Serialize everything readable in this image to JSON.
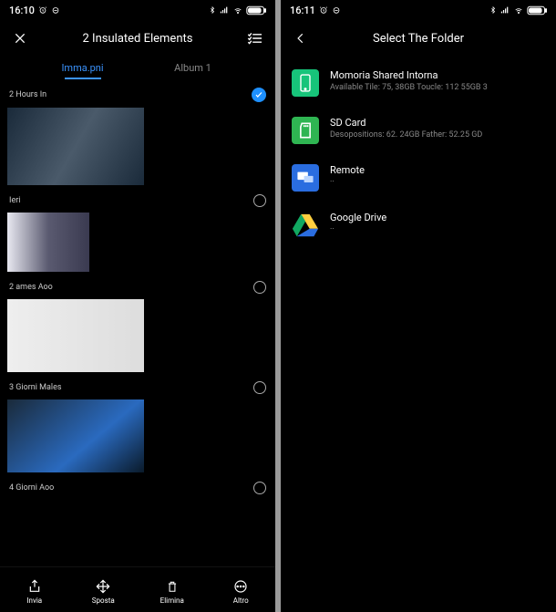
{
  "left": {
    "status": {
      "time": "16:10"
    },
    "header": {
      "title": "2 Insulated Elements"
    },
    "tabs": {
      "images": "Imma.pni",
      "album": "Album 1"
    },
    "sections": [
      {
        "label": "2 Hours In",
        "selected": true
      },
      {
        "label": "Ieri",
        "selected": false
      },
      {
        "label": "2 ames Aoo",
        "selected": false
      },
      {
        "label": "3 Giorni Males",
        "selected": false
      },
      {
        "label": "4 Giorni Aoo",
        "selected": false
      }
    ],
    "bottom": {
      "share": "Invia",
      "move": "Sposta",
      "delete": "Elimina",
      "more": "Altro"
    }
  },
  "right": {
    "status": {
      "time": "16:11"
    },
    "header": {
      "title": "Select The Folder"
    },
    "folders": [
      {
        "title": "Momoria Shared Intorna",
        "sub": "Available Tile: 75, 38GB Toucle: 112 55GB 3"
      },
      {
        "title": "SD Card",
        "sub": "Desopositions: 62. 24GB Father: 52.25 GD"
      },
      {
        "title": "Remote",
        "sub": "··"
      },
      {
        "title": "Google Drive",
        "sub": "··"
      }
    ]
  }
}
